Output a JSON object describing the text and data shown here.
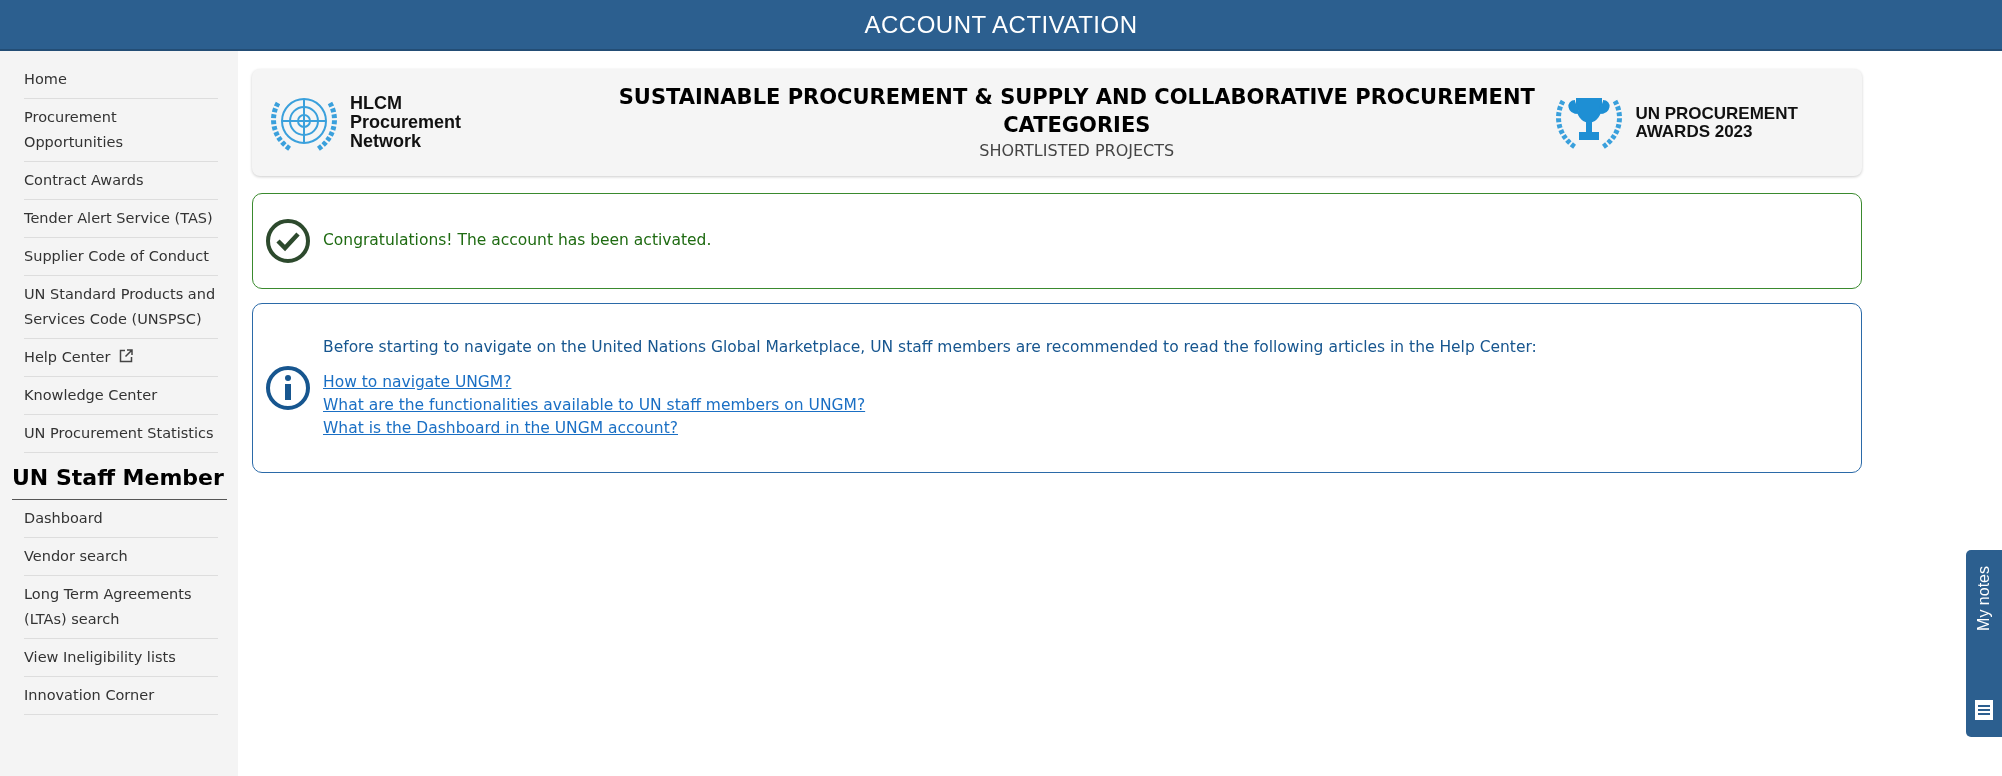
{
  "header": {
    "title": "ACCOUNT ACTIVATION"
  },
  "sidebar": {
    "items": [
      {
        "label": "Home",
        "external": false
      },
      {
        "label": "Procurement Opportunities",
        "external": false
      },
      {
        "label": "Contract Awards",
        "external": false
      },
      {
        "label": "Tender Alert Service (TAS)",
        "external": false
      },
      {
        "label": "Supplier Code of Conduct",
        "external": false
      },
      {
        "label": "UN Standard Products and Services Code (UNSPSC)",
        "external": false
      },
      {
        "label": "Help Center",
        "external": true
      },
      {
        "label": "Knowledge Center",
        "external": false
      },
      {
        "label": "UN Procurement Statistics",
        "external": false
      }
    ],
    "section": {
      "heading": "UN Staff Member",
      "items": [
        {
          "label": "Dashboard",
          "external": false
        },
        {
          "label": "Vendor search",
          "external": false
        },
        {
          "label": "Long Term Agreements (LTAs) search",
          "external": false
        },
        {
          "label": "View Ineligibility lists",
          "external": false
        },
        {
          "label": "Innovation Corner",
          "external": false
        }
      ]
    }
  },
  "banner": {
    "left_logo": [
      "HLCM",
      "Procurement",
      "Network"
    ],
    "title": "SUSTAINABLE PROCUREMENT & SUPPLY AND COLLABORATIVE PROCUREMENT CATEGORIES",
    "subtitle": "SHORTLISTED PROJECTS",
    "right_logo": [
      "UN PROCUREMENT",
      "AWARDS 2023"
    ]
  },
  "alerts": [
    {
      "kind": "success",
      "text": "Congratulations! The account has been activated."
    },
    {
      "kind": "info",
      "text": "Before starting to navigate on the United Nations Global Marketplace, UN staff members are recommended to read the following articles in the Help Center:",
      "links": [
        "How to navigate UNGM?",
        "What are the functionalities available to UN staff members on UNGM?",
        "What is the Dashboard in the UNGM account?"
      ]
    }
  ],
  "notes_tab": {
    "label": "My notes"
  }
}
